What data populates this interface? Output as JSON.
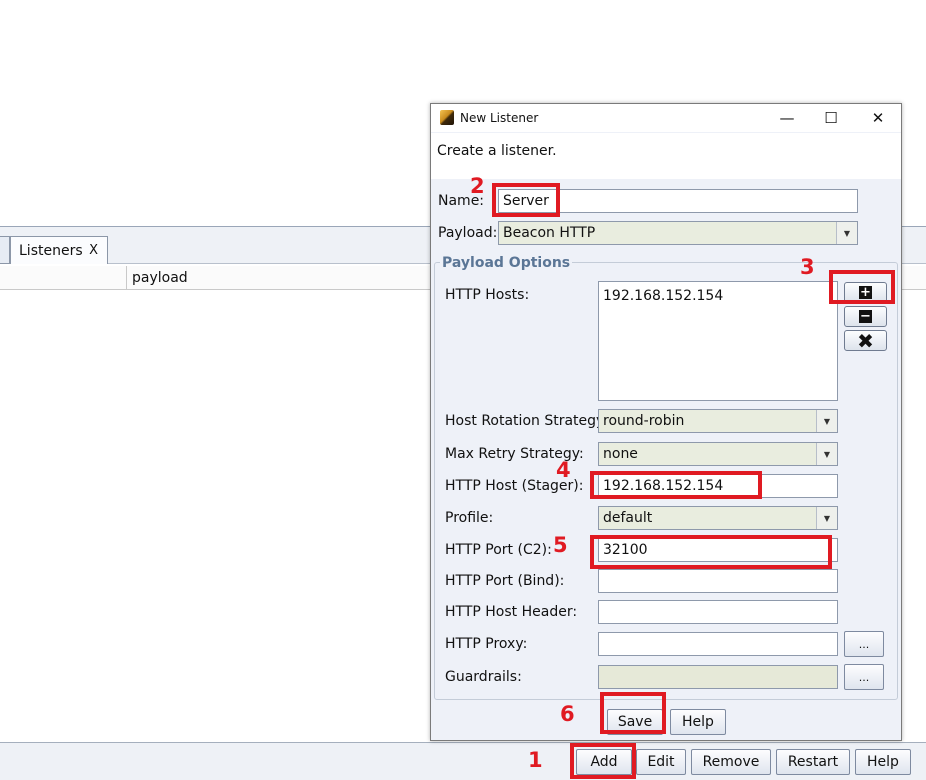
{
  "app": {
    "tab_label": "Listeners",
    "tab_close": "X",
    "column_header": "payload",
    "buttons": {
      "add": "Add",
      "edit": "Edit",
      "remove": "Remove",
      "restart": "Restart",
      "help": "Help"
    }
  },
  "dialog": {
    "title": "New Listener",
    "controls": {
      "minimize": "—",
      "maximize": "☐",
      "close": "✕"
    },
    "description": "Create a listener.",
    "name_label": "Name:",
    "name_value": "Server",
    "payload_label": "Payload:",
    "payload_value": "Beacon HTTP",
    "group_title": "Payload Options",
    "http_hosts_label": "HTTP Hosts:",
    "http_hosts": [
      "192.168.152.154"
    ],
    "host_rotation_label": "Host Rotation Strategy:",
    "host_rotation_value": "round-robin",
    "max_retry_label": "Max Retry Strategy:",
    "max_retry_value": "none",
    "http_host_stager_label": "HTTP Host (Stager):",
    "http_host_stager_value": "192.168.152.154",
    "profile_label": "Profile:",
    "profile_value": "default",
    "http_port_c2_label": "HTTP Port (C2):",
    "http_port_c2_value": "32100",
    "http_port_bind_label": "HTTP Port (Bind):",
    "http_port_bind_value": "",
    "http_host_header_label": "HTTP Host Header:",
    "http_host_header_value": "",
    "http_proxy_label": "HTTP Proxy:",
    "http_proxy_value": "",
    "guardrails_label": "Guardrails:",
    "guardrails_value": "",
    "ellipsis": "...",
    "save": "Save",
    "help": "Help",
    "icons": {
      "add": "add-icon",
      "remove": "remove-icon",
      "clear": "clear-icon"
    }
  },
  "annotations": [
    "1",
    "2",
    "3",
    "4",
    "5",
    "6"
  ],
  "colors": {
    "annotation": "#e01a22",
    "group_title": "#5b7696",
    "combo_bg": "#e9eddf"
  }
}
